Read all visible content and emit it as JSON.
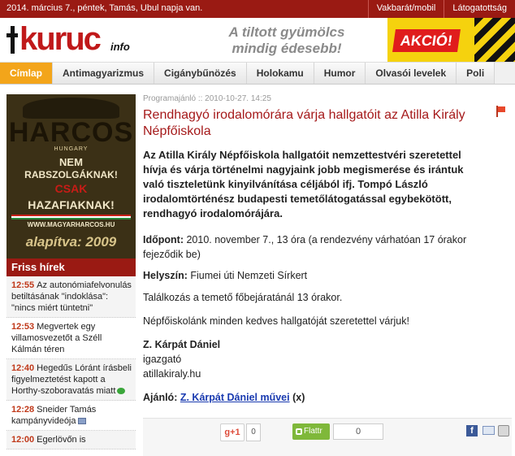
{
  "topbar": {
    "date_text": "2014. március 7., péntek, Tamás, Ubul napja van.",
    "links": [
      "Vakbarát/mobil",
      "Látogatottság"
    ]
  },
  "header": {
    "logo_text": "kuruc",
    "logo_suffix": "info",
    "slogan_line1": "A tiltott gyümölcs",
    "slogan_line2": "mindig édesebb!",
    "promo_text": "AKCIÓ!"
  },
  "nav": {
    "tabs": [
      {
        "label": "Címlap",
        "active": true
      },
      {
        "label": "Antimagyarizmus",
        "active": false
      },
      {
        "label": "Cigánybűnözés",
        "active": false
      },
      {
        "label": "Holokamu",
        "active": false
      },
      {
        "label": "Humor",
        "active": false
      },
      {
        "label": "Olvasói levelek",
        "active": false
      },
      {
        "label": "Poli",
        "active": false
      }
    ]
  },
  "banner": {
    "title": "HARCOS",
    "subtitle": "HUNGARY",
    "line1": "NEM",
    "line2": "RABSZOLGÁKNAK!",
    "line3": "CSAK",
    "line4": "HAZAFIAKNAK!",
    "url": "WWW.MAGYARHARCOS.HU",
    "founded": "alapítva: 2009"
  },
  "friss": {
    "title": "Friss hírek",
    "items": [
      {
        "time": "12:55",
        "text": "Az autonómiafelvonulás betiltásának \"indoklása\": \"nincs miért tüntetni\"",
        "icon": ""
      },
      {
        "time": "12:53",
        "text": "Megvertek egy villamosvezetőt a Széll Kálmán téren",
        "icon": ""
      },
      {
        "time": "12:40",
        "text": "Hegedűs Lóránt írásbeli figyelmeztetést kapott a Horthy-szoboravatás miatt",
        "icon": "green"
      },
      {
        "time": "12:28",
        "text": "Sneider Tamás kampányvideója",
        "icon": "video"
      },
      {
        "time": "12:00",
        "text": "Egerlövőn is",
        "icon": ""
      }
    ]
  },
  "article": {
    "meta": "Programajánló :: 2010-10-27. 14:25",
    "title": "Rendhagyó irodalomórára várja hallgatóit az Atilla Király Népfőiskola",
    "lead": "Az Atilla Király Népfőiskola hallgatóit nemzettestvéri szeretettel hívja és várja történelmi nagyjaink jobb megismerése és irántuk való tiszteletünk kinyilvánítása céljából ifj. Tompó László irodalomtörténész budapesti temetőlátogatással egybekötött, rendhagyó irodalomórájára.",
    "idopont_label": "Időpont:",
    "idopont_value": "2010. november 7., 13 óra (a rendezvény várhatóan 17 órakor fejeződik be)",
    "helyszin_label": "Helyszín:",
    "helyszin_value": "Fiumei úti Nemzeti Sírkert",
    "talalkozas": "Találkozás a temető főbejáratánál 13 órakor.",
    "nepfoiskola": "Népfőiskolánk minden kedves hallgatóját szeretettel várjuk!",
    "signature_name": "Z. Kárpát Dániel",
    "signature_role": "igazgató",
    "signature_site": "atillakiraly.hu",
    "ajanlo_label": "Ajánló:",
    "ajanlo_link": "Z. Kárpát Dániel művei",
    "ajanlo_suffix": "(x)"
  },
  "share": {
    "gplus_label": "g+1",
    "gplus_count": "0",
    "flattr_label": "Flattr",
    "flattr_count": "0",
    "facebook_glyph": "f"
  }
}
